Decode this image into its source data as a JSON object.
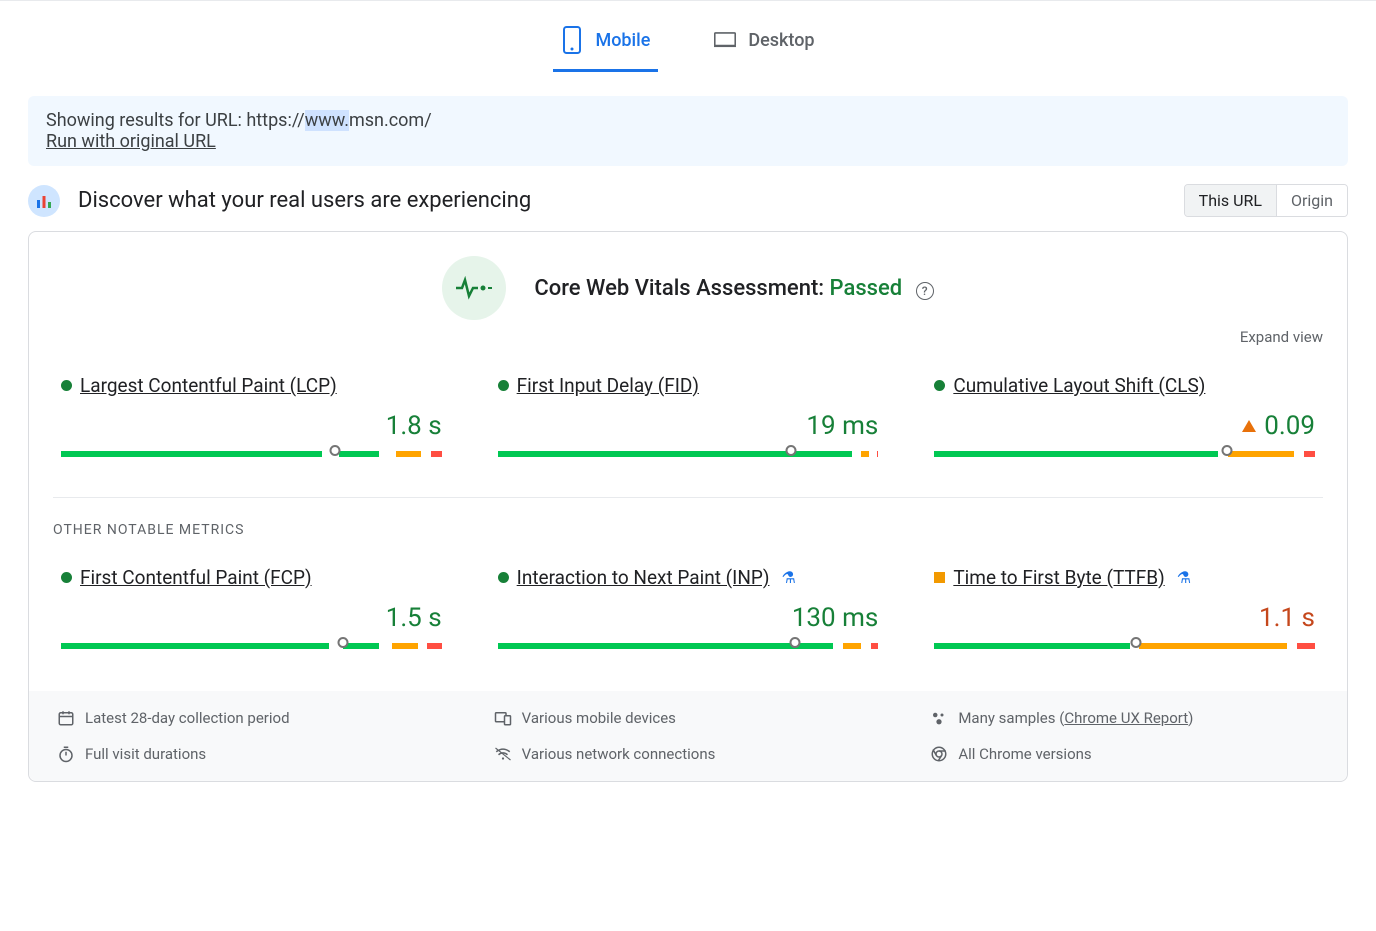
{
  "tabs": {
    "mobile": "Mobile",
    "desktop": "Desktop"
  },
  "notice": {
    "showing_results": "Showing results for URL: ",
    "url_prefix": "https://",
    "url_highlighted": "www.",
    "url_rest": "msn.com/",
    "run_original": "Run with original URL"
  },
  "header": {
    "title": "Discover what your real users are experiencing",
    "toggle_this_url": "This URL",
    "toggle_origin": "Origin"
  },
  "cwv": {
    "label": "Core Web Vitals Assessment: ",
    "status": "Passed",
    "expand": "Expand view"
  },
  "metrics": {
    "core": [
      {
        "name": "Largest Contentful Paint (LCP)",
        "value": "1.8 s",
        "status": "good",
        "marker_pct": 72,
        "segs": [
          72,
          3,
          11,
          3,
          7,
          1,
          3
        ]
      },
      {
        "name": "First Input Delay (FID)",
        "value": "19 ms",
        "status": "good",
        "marker_pct": 77,
        "segs": [
          96,
          1,
          2,
          0.5,
          0.5
        ]
      },
      {
        "name": "Cumulative Layout Shift (CLS)",
        "value": "0.09",
        "status": "good",
        "warn_icon": true,
        "marker_pct": 77,
        "segs": [
          77,
          1,
          18,
          1,
          3
        ]
      }
    ],
    "other_label": "OTHER NOTABLE METRICS",
    "other": [
      {
        "name": "First Contentful Paint (FCP)",
        "value": "1.5 s",
        "status": "good",
        "marker_pct": 74,
        "segs": [
          74,
          2,
          10,
          2,
          7,
          1,
          4
        ]
      },
      {
        "name": "Interaction to Next Paint (INP)",
        "value": "130 ms",
        "status": "good",
        "beaker": true,
        "marker_pct": 78,
        "segs": [
          91,
          1,
          5,
          1,
          2
        ]
      },
      {
        "name": "Time to First Byte (TTFB)",
        "value": "1.1 s",
        "status": "warn",
        "beaker": true,
        "marker_pct": 53,
        "segs": [
          53,
          1,
          40,
          1,
          5
        ]
      }
    ]
  },
  "footer": {
    "period": "Latest 28-day collection period",
    "devices": "Various mobile devices",
    "samples_prefix": "Many samples (",
    "samples_link": "Chrome UX Report",
    "samples_suffix": ")",
    "durations": "Full visit durations",
    "network": "Various network connections",
    "chrome": "All Chrome versions"
  }
}
